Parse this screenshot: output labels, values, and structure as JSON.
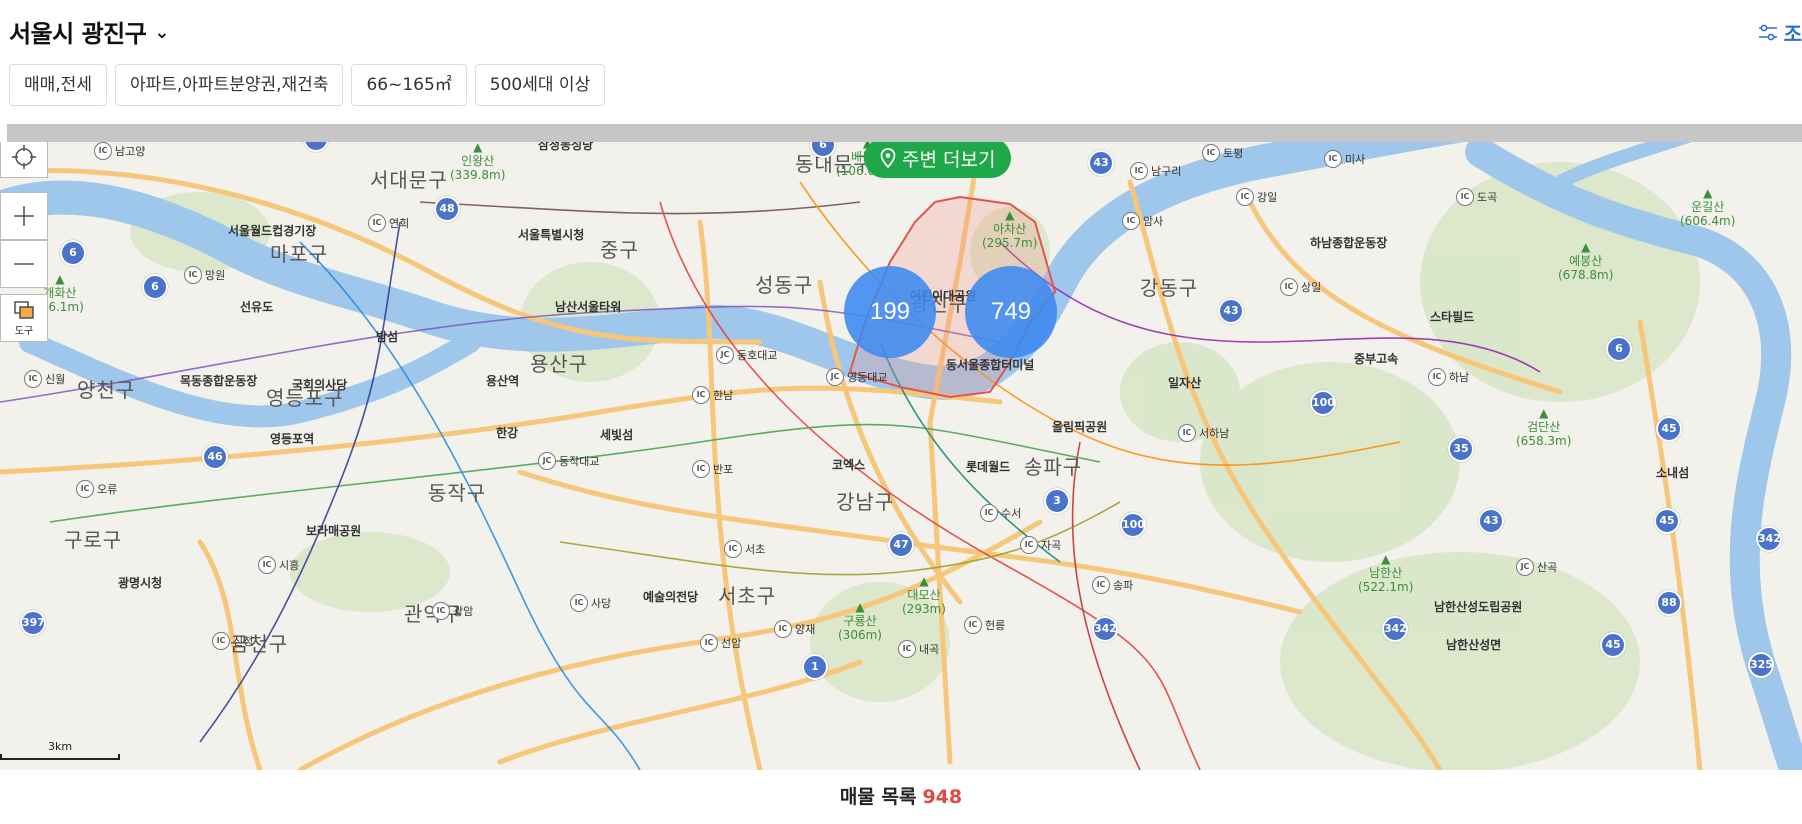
{
  "header": {
    "title": "서울시 광진구",
    "filter_link_label": "조",
    "chips": [
      "매매,전세",
      "아파트,아파트분양권,재건축",
      "66~165㎡",
      "500세대 이상"
    ]
  },
  "map": {
    "search_nearby_label": "주변 더보기",
    "tool_label": "도구",
    "scale_label": "3km",
    "clusters": [
      {
        "id": "cluster-199",
        "count": "199"
      },
      {
        "id": "cluster-749",
        "count": "749"
      }
    ],
    "districts": [
      "서대문구",
      "마포구",
      "중구",
      "동대문구",
      "성동구",
      "광진구",
      "강동구",
      "용산구",
      "양천구",
      "영등포구",
      "동작구",
      "강남구",
      "송파구",
      "구로구",
      "관악구",
      "서초구",
      "금천구"
    ],
    "mountains": [
      {
        "name": "인왕산",
        "height": "(339.8m)"
      },
      {
        "name": "배봉산",
        "height": "(106.03m)"
      },
      {
        "name": "아차산",
        "height": "(295.7m)"
      },
      {
        "name": "운길산",
        "height": "(606.4m)"
      },
      {
        "name": "예봉산",
        "height": "(678.8m)"
      },
      {
        "name": "개화산",
        "height": "(96.1m)"
      },
      {
        "name": "검단산",
        "height": "(658.3m)"
      },
      {
        "name": "대모산",
        "height": "(293m)"
      },
      {
        "name": "구룡산",
        "height": "(306m)"
      },
      {
        "name": "남한산",
        "height": "(522.1m)"
      }
    ],
    "pois": [
      "삼청동성당",
      "서울특별시청",
      "남산서울타워",
      "국회의사당",
      "서울월드컵경기장",
      "목동종합운동장",
      "하남종합운동장",
      "스타필드",
      "동서울종합터미널",
      "일자산",
      "올림픽공원",
      "코엑스",
      "롯데월드",
      "예술의전당",
      "보라매공원",
      "영등포역",
      "용산역",
      "광명시청",
      "남한산성도립공원",
      "어린이대공원",
      "한강",
      "세빛섬",
      "밤섬",
      "선유도",
      "소내섬",
      "중부고속",
      "남한산성면"
    ],
    "ics": [
      "남고양",
      "연희",
      "망원",
      "신월",
      "오류",
      "시흥",
      "광암",
      "신정",
      "토평",
      "미사",
      "남구리",
      "강일",
      "도곡",
      "암사",
      "상일",
      "하남",
      "서하남",
      "수서",
      "자곡",
      "송파",
      "헌릉",
      "내곡",
      "양재",
      "선암",
      "서초",
      "사당",
      "반포",
      "한남",
      "산곡"
    ],
    "jcs": [
      "동호대교",
      "영동대교",
      "동작대교"
    ],
    "routes": [
      "1",
      "6",
      "43",
      "48",
      "6",
      "6",
      "43",
      "6",
      "100",
      "35",
      "45",
      "46",
      "47",
      "3",
      "100",
      "43",
      "45",
      "342",
      "88",
      "342",
      "342",
      "397",
      "45",
      "325",
      "1"
    ]
  },
  "footer": {
    "label": "매물 목록",
    "count": "948"
  }
}
